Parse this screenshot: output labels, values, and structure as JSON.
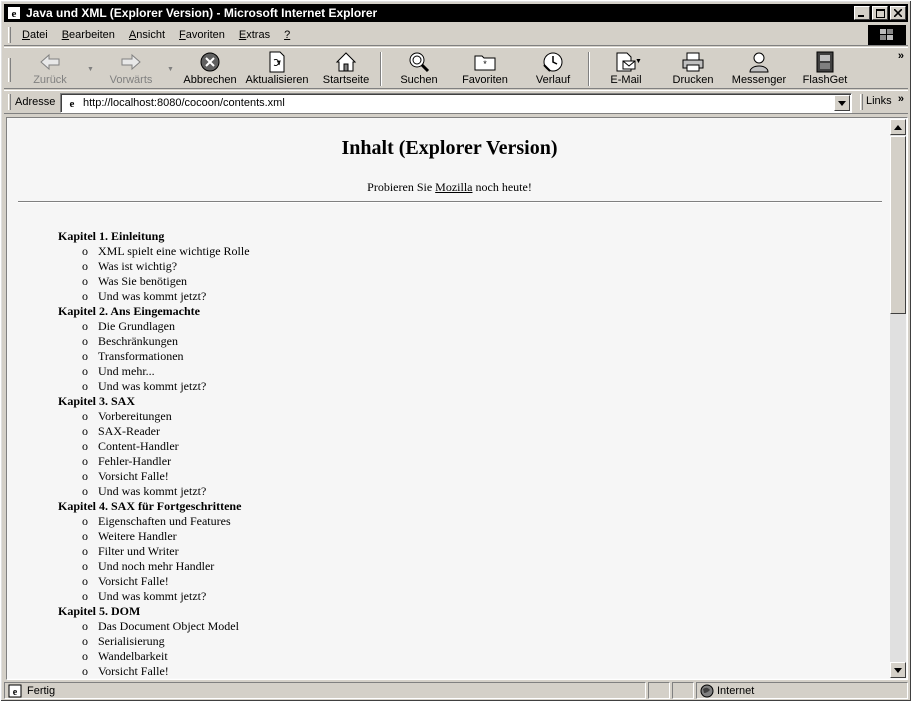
{
  "window": {
    "title": "Java und XML (Explorer Version) - Microsoft Internet Explorer",
    "controls": {
      "minimize": "_",
      "maximize": "□",
      "close": "×"
    }
  },
  "menubar": {
    "items": [
      {
        "label": "Datei",
        "accel": "D",
        "rest": "atei"
      },
      {
        "label": "Bearbeiten",
        "accel": "B",
        "rest": "earbeiten"
      },
      {
        "label": "Ansicht",
        "accel": "A",
        "rest": "nsicht"
      },
      {
        "label": "Favoriten",
        "accel": "F",
        "rest": "avoriten"
      },
      {
        "label": "Extras",
        "accel": "E",
        "rest": "xtras"
      },
      {
        "label": "?",
        "accel": "?",
        "rest": ""
      }
    ]
  },
  "toolbar": {
    "back": "Zurück",
    "forward": "Vorwärts",
    "stop": "Abbrechen",
    "refresh": "Aktualisieren",
    "home": "Startseite",
    "search": "Suchen",
    "favorites": "Favoriten",
    "history": "Verlauf",
    "mail": "E-Mail",
    "print": "Drucken",
    "messenger": "Messenger",
    "flashget": "FlashGet",
    "more": "»"
  },
  "addressbar": {
    "label": "Adresse",
    "url": "http://localhost:8080/cocoon/contents.xml",
    "links_label": "Links",
    "links_more": "»"
  },
  "page": {
    "title": "Inhalt (Explorer Version)",
    "try_prefix": "Probieren Sie ",
    "try_link": "Mozilla",
    "try_suffix": " noch heute!",
    "bullet": "o",
    "chapters": [
      {
        "title": "Kapitel 1. Einleitung",
        "items": [
          "XML spielt eine wichtige Rolle",
          "Was ist wichtig?",
          "Was Sie benötigen",
          "Und was kommt jetzt?"
        ]
      },
      {
        "title": "Kapitel 2. Ans Eingemachte",
        "items": [
          "Die Grundlagen",
          "Beschränkungen",
          "Transformationen",
          "Und mehr...",
          "Und was kommt jetzt?"
        ]
      },
      {
        "title": "Kapitel 3. SAX",
        "items": [
          "Vorbereitungen",
          "SAX-Reader",
          "Content-Handler",
          "Fehler-Handler",
          "Vorsicht Falle!",
          "Und was kommt jetzt?"
        ]
      },
      {
        "title": "Kapitel 4. SAX für Fortgeschrittene",
        "items": [
          "Eigenschaften und Features",
          "Weitere Handler",
          "Filter und Writer",
          "Und noch mehr Handler",
          "Vorsicht Falle!",
          "Und was kommt jetzt?"
        ]
      },
      {
        "title": "Kapitel 5. DOM",
        "items": [
          "Das Document Object Model",
          "Serialisierung",
          "Wandelbarkeit",
          "Vorsicht Falle!"
        ]
      }
    ]
  },
  "statusbar": {
    "status": "Fertig",
    "zone": "Internet"
  }
}
